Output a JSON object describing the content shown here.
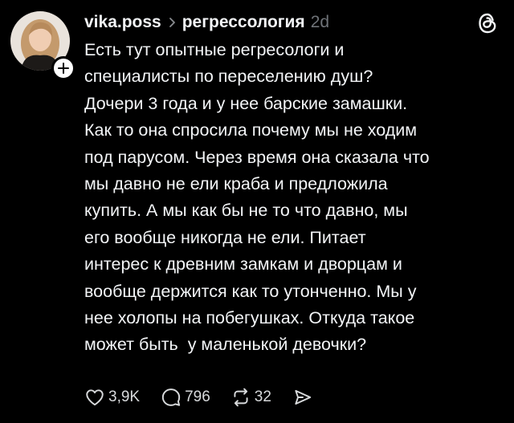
{
  "post": {
    "username": "vika.poss",
    "topic": "регрессология",
    "time": "2d",
    "text": "Есть тут опытные регресологи и\nспециалисты по переселению душ?\nДочери 3 года и у нее барские замашки.\nКак то она спросила почему мы не ходим\nпод парусом. Через время она сказала что\nмы давно не ели краба и предложила\nкупить. А мы как бы не то что давно, мы\nего вообще никогда не ели. Питает\nинтерес к древним замкам и дворцам и\nвообще держится как то утонченно. Мы у\nнее холопы на побегушках. Откуда такое\nможет быть  у маленькой девочки?"
  },
  "actions": {
    "like_count": "3,9K",
    "reply_count": "796",
    "repost_count": "32"
  },
  "icons": {
    "avatar": "avatar",
    "follow": "plus-icon",
    "separator": "chevron-right-icon",
    "app": "threads-logo-icon",
    "like": "heart-icon",
    "reply": "comment-icon",
    "repost": "repost-icon",
    "share": "send-icon"
  },
  "colors": {
    "background": "#000000",
    "text": "#f3f5f7",
    "muted": "#6f7378"
  }
}
